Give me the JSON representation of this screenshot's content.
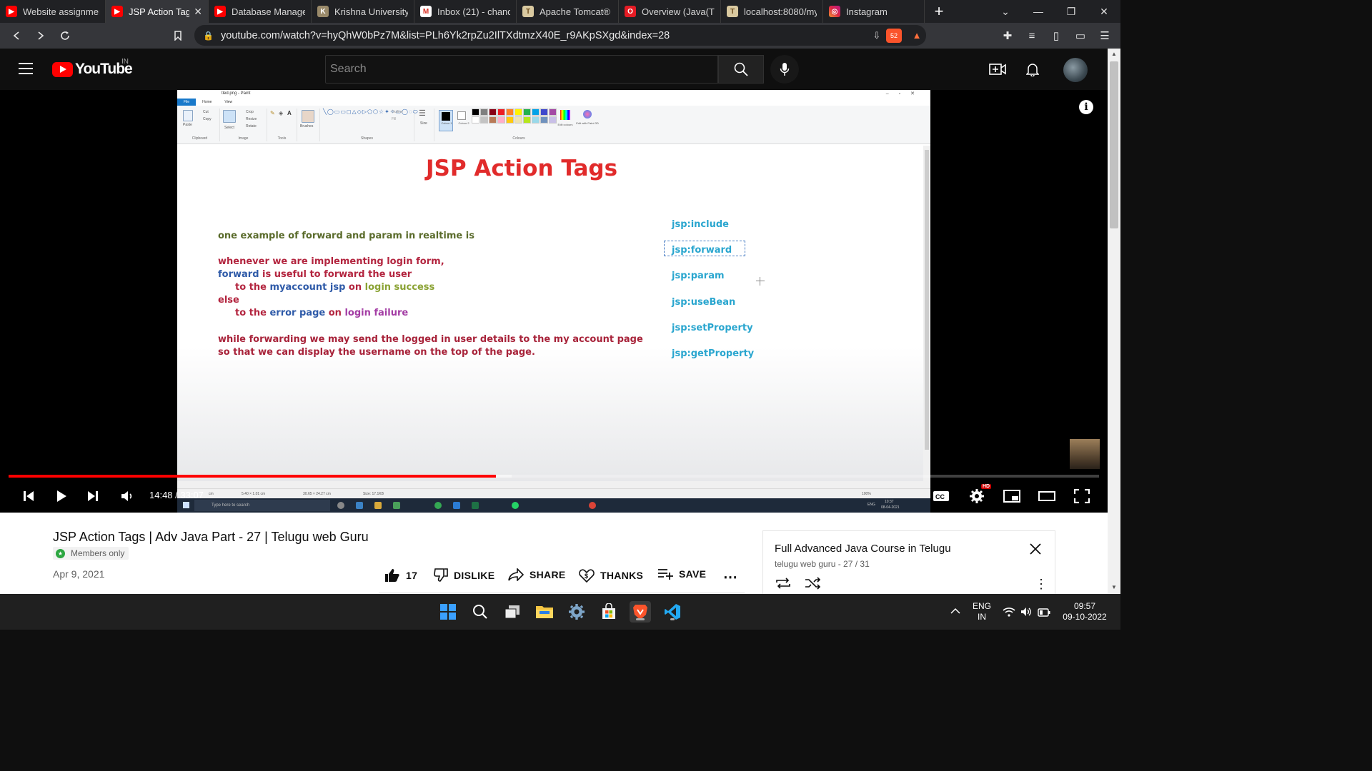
{
  "browser": {
    "tabs": [
      {
        "title": "Website assignmen",
        "icon": "youtube-icon",
        "active": false
      },
      {
        "title": "JSP Action Tags",
        "icon": "youtube-icon",
        "active": true
      },
      {
        "title": "Database Managem",
        "icon": "youtube-icon",
        "active": false
      },
      {
        "title": "Krishna University",
        "icon": "university-icon",
        "active": false
      },
      {
        "title": "Inbox (21) - chandu",
        "icon": "gmail-icon",
        "active": false
      },
      {
        "title": "Apache Tomcat® -",
        "icon": "tomcat-icon",
        "active": false
      },
      {
        "title": "Overview (Java(TM)",
        "icon": "oracle-icon",
        "active": false
      },
      {
        "title": "localhost:8080/myp",
        "icon": "tomcat-icon",
        "active": false
      },
      {
        "title": "Instagram",
        "icon": "instagram-icon",
        "active": false
      }
    ],
    "url": "youtube.com/watch?v=hyQhW0bPz7M&list=PLh6Yk2rpZu2IlTXdtmzX40E_r9AKpSXgd&index=28",
    "brave_shield_count": "52"
  },
  "youtube": {
    "logo_text": "YouTube",
    "country_code": "IN",
    "search_placeholder": "Search"
  },
  "video_frame": {
    "paint_title": "tled.png - Paint",
    "ribbon_tabs": [
      "File",
      "Home",
      "View"
    ],
    "ribbon_groups": [
      "Clipboard",
      "Image",
      "Tools",
      "Shapes",
      "Colours"
    ],
    "ribbon_labels": {
      "paste": "Paste",
      "cut": "Cut",
      "copy": "Copy",
      "select": "Select",
      "crop": "Crop",
      "resize": "Resize",
      "rotate": "Rotate",
      "brushes": "Brushes",
      "outline": "Outline",
      "fill": "Fill",
      "size": "Size",
      "colour1": "Colour 1",
      "colour2": "Colour 2",
      "edit_colours": "Edit colours",
      "paint3d": "Edit with Paint 3D"
    },
    "palette": [
      "#000000",
      "#7f7f7f",
      "#880015",
      "#ed1c24",
      "#ff7f27",
      "#fff200",
      "#22b14c",
      "#00a2e8",
      "#3f48cc",
      "#a349a4",
      "#ffffff",
      "#c3c3c3",
      "#b97a57",
      "#ffaec9",
      "#ffc90e",
      "#efe4b0",
      "#b5e61d",
      "#99d9ea",
      "#7092be",
      "#c8bfe7"
    ],
    "slide_title": "JSP Action Tags",
    "lines": {
      "l1": "one example of forward and param in realtime is",
      "l2": "whenever we are implementing login form,",
      "l3a": "forward",
      "l3b": " is useful to forward the user",
      "l4a": "to the ",
      "l4b": "myaccount jsp",
      "l4c": " on ",
      "l4d": "login success",
      "l5": "else",
      "l6a": "to the ",
      "l6b": "error page",
      "l6c": " on ",
      "l6d": "login failure",
      "l7": "while forwarding we may send the logged in user details to the my account page",
      "l8": "so that we can display the username on the top of the page."
    },
    "tags": [
      "jsp:include",
      "jsp:forward",
      "jsp:param",
      "jsp:useBean",
      "jsp:setProperty",
      "jsp:getProperty"
    ],
    "status": {
      "s1": "cm",
      "s2": "5.40 × 1.01 cm",
      "s3": "30.65 × 24.27 cm",
      "s4": "Size: 17.1KB",
      "zoom": "100%"
    },
    "inner_search": "Type here to search",
    "inner_clock": "10:37",
    "inner_date": "08-04-2021",
    "inner_lang": "ENG"
  },
  "player": {
    "current_time": "14:48",
    "duration": "33:07",
    "time_display": "14:48 / 33:07",
    "progress_fraction": 0.447,
    "quality_badge": "HD"
  },
  "video_info": {
    "title": "JSP Action Tags | Adv Java Part - 27 | Telugu web Guru",
    "members_badge": "Members only",
    "date": "Apr 9, 2021",
    "like_count": "17",
    "dislike_label": "DISLIKE",
    "share_label": "SHARE",
    "thanks_label": "THANKS",
    "save_label": "SAVE"
  },
  "playlist": {
    "title": "Full Advanced Java Course in Telugu",
    "subtitle": "telugu web guru - 27 / 31"
  },
  "taskbar": {
    "lang_line1": "ENG",
    "lang_line2": "IN",
    "time": "09:57",
    "date": "09-10-2022"
  }
}
